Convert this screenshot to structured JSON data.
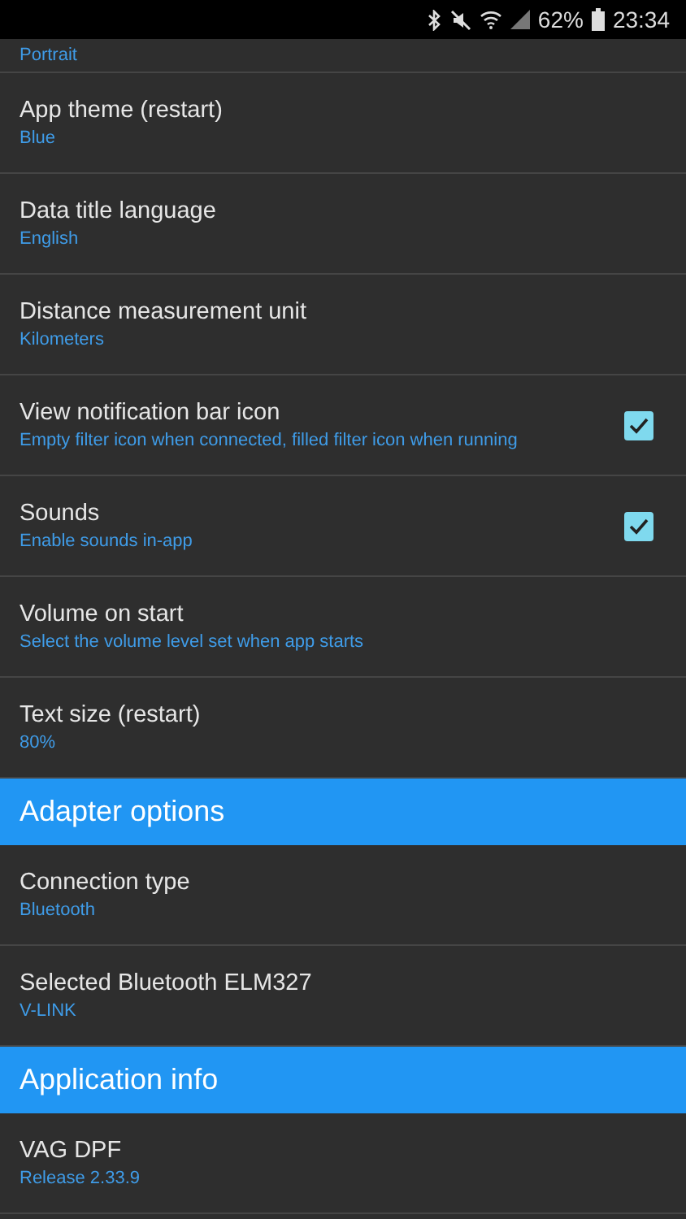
{
  "status_bar": {
    "battery": "62%",
    "time": "23:34"
  },
  "sections": [
    {
      "items": [
        {
          "kind": "plain",
          "summary": "Portrait"
        },
        {
          "kind": "plain",
          "title": "App theme (restart)",
          "summary": "Blue"
        },
        {
          "kind": "plain",
          "title": "Data title language",
          "summary": "English"
        },
        {
          "kind": "plain",
          "title": "Distance measurement unit",
          "summary": "Kilometers"
        },
        {
          "kind": "checkbox",
          "title": "View notification bar icon",
          "summary": "Empty filter icon when connected, filled filter icon when running",
          "checked": true
        },
        {
          "kind": "checkbox",
          "title": "Sounds",
          "summary": "Enable sounds in-app",
          "checked": true
        },
        {
          "kind": "plain",
          "title": "Volume on start",
          "summary": "Select the volume level set when app starts"
        },
        {
          "kind": "plain",
          "title": "Text size (restart)",
          "summary": "80%"
        }
      ]
    },
    {
      "header": "Adapter options",
      "items": [
        {
          "kind": "plain",
          "title": "Connection type",
          "summary": "Bluetooth"
        },
        {
          "kind": "plain",
          "title": "Selected Bluetooth ELM327",
          "summary": "V-LINK"
        }
      ]
    },
    {
      "header": "Application info",
      "items": [
        {
          "kind": "plain",
          "title": "VAG DPF",
          "summary": "Release 2.33.9"
        }
      ]
    }
  ]
}
